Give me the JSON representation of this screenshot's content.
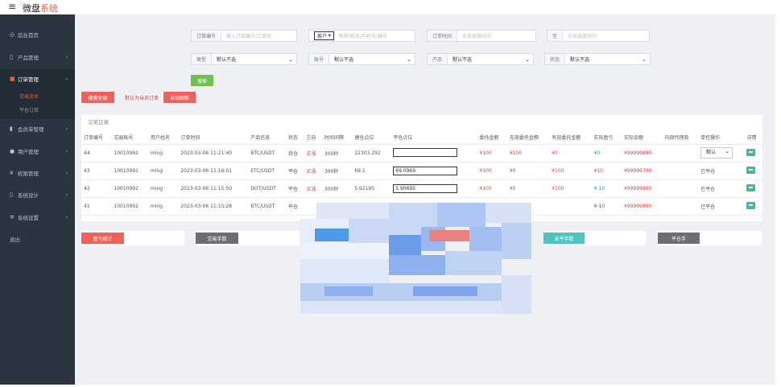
{
  "app": {
    "menu_icon": "menu-icon",
    "brand_main": "微盘",
    "brand_accent": "系统"
  },
  "sidebar": {
    "items": [
      {
        "label": "后台首页",
        "icon": "dashboard-icon"
      },
      {
        "label": "产品管理",
        "icon": "product-icon"
      },
      {
        "label": "订单管理",
        "icon": "order-icon"
      },
      {
        "label": "会员单管理",
        "icon": "member-icon"
      },
      {
        "label": "用户管理",
        "icon": "user-icon"
      },
      {
        "label": "权限管理",
        "icon": "lock-icon"
      },
      {
        "label": "系统设计",
        "icon": "doc-icon"
      },
      {
        "label": "系统设置",
        "icon": "gear-icon"
      },
      {
        "label": "退出",
        "icon": ""
      }
    ],
    "sub": {
      "trade": "交易流水",
      "history": "平仓订单"
    }
  },
  "filters": {
    "order_no_label": "订单编号",
    "order_no_placeholder": "输入订单编号/订单时",
    "customer_select": "客户",
    "customer_placeholder": "昵称/姓名/手机号/编号",
    "time_label": "订单时间",
    "time_start_placeholder": "点击选择时间",
    "time_to": "至",
    "time_end_placeholder": "点击选择时间",
    "type_label": "类型",
    "type_value": "默认不选",
    "account_label": "账号",
    "account_value": "默认不选",
    "product_label": "产品",
    "product_value": "默认不选",
    "status_label": "状态",
    "status_value": "默认不选",
    "search_button": "搜索"
  },
  "actions": {
    "search_all": "搜索全部",
    "today_default": "默认为当天订单",
    "auto_refresh": "自动刷新"
  },
  "table": {
    "title": "交易记录",
    "headers": [
      "订单编号",
      "交易账号",
      "用户姓名",
      "订单时间",
      "产品信息",
      "状态",
      "方向",
      "时间间隔",
      "建仓点位",
      "平仓点位",
      "委托金额",
      "无效委托金额",
      "有效委托金额",
      "实际盈亏",
      "实际余额",
      "内部代理商",
      "单控操作",
      "详情"
    ],
    "rows": [
      {
        "id": "44",
        "acct": "10010992",
        "user": "ming",
        "time": "2023-03-06 11:21:40",
        "product": "BTC/USDT",
        "status": "持仓",
        "dir": "买涨",
        "interval": "300秒",
        "open": "22303.292",
        "close": "",
        "amount": "¥100",
        "invalid": "¥100",
        "valid": "¥0",
        "pnl": "¥0",
        "balance": "¥99999890",
        "agent": "",
        "op": "默认",
        "op_type": "select"
      },
      {
        "id": "43",
        "acct": "10010992",
        "user": "ming",
        "time": "2023-03-06 11:16:01",
        "product": "ETC/USDT",
        "status": "平仓",
        "dir": "买涨",
        "interval": "300秒",
        "open": "69.1",
        "close": "69.0969",
        "amount": "¥100",
        "invalid": "¥0",
        "valid": "¥100",
        "pnl": "¥10",
        "balance": "¥99999700",
        "agent": "",
        "op": "已平仓",
        "op_type": "text"
      },
      {
        "id": "42",
        "acct": "10010992",
        "user": "ming",
        "time": "2023-03-06 11:15:50",
        "product": "DOT/USDT",
        "status": "平仓",
        "dir": "买涨",
        "interval": "300秒",
        "open": "5.92195",
        "close": "5.90695",
        "amount": "¥100",
        "invalid": "¥0",
        "valid": "¥100",
        "pnl": "¥-10",
        "balance": "¥99999800",
        "agent": "",
        "op": "已平仓",
        "op_type": "text"
      },
      {
        "id": "41",
        "acct": "10010992",
        "user": "ming",
        "time": "2023-03-06 11:15:28",
        "product": "BTC/USDT",
        "status": "平仓",
        "dir": "",
        "interval": "",
        "open": "",
        "close": "",
        "amount": "",
        "invalid": "",
        "valid": "",
        "pnl": "¥-10",
        "balance": "¥99999800",
        "agent": "",
        "op": "已平仓",
        "op_type": "text"
      }
    ]
  },
  "stats": {
    "profit": "盈亏统计",
    "volume": "交易手数",
    "unsettled": "未平手数",
    "closed": "平仓手"
  },
  "colors": {
    "accent": "#e8613b",
    "sidebar_bg": "#2a3541",
    "green": "#6cc24a",
    "teal": "#4ec5c1",
    "gray": "#6e6e6e",
    "red": "#f2605e"
  }
}
